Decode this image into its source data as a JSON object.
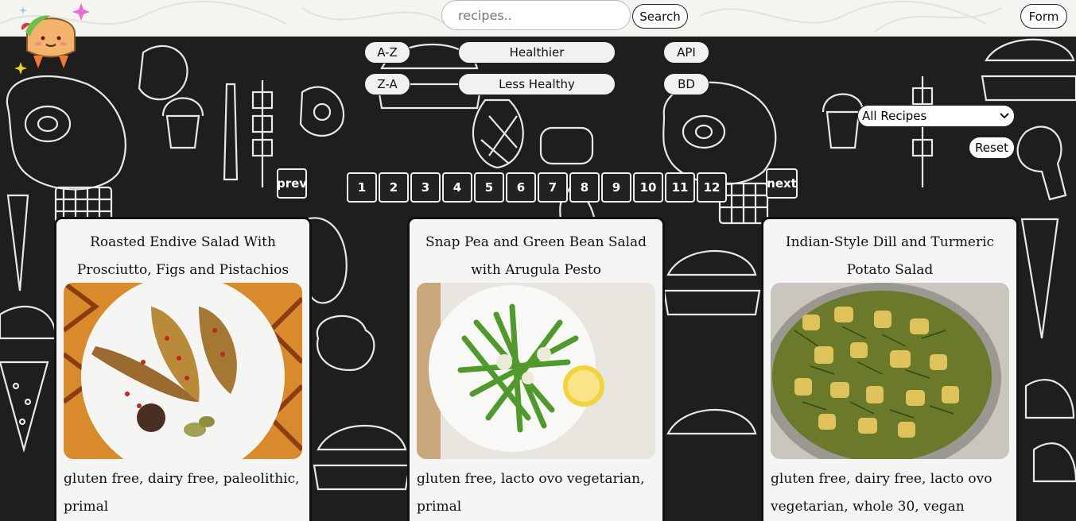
{
  "search": {
    "placeholder": "recipes..",
    "button_label": "Search"
  },
  "header": {
    "form_label": "Form"
  },
  "filters": {
    "az": "A-Z",
    "za": "Z-A",
    "healthier": "Healthier",
    "less_healthy": "Less Healthy",
    "api": "API",
    "bd": "BD"
  },
  "select": {
    "selected": "All Recipes"
  },
  "reset_label": "Reset",
  "pagination": {
    "prev": "prev",
    "next": "next",
    "pages": [
      "1",
      "2",
      "3",
      "4",
      "5",
      "6",
      "7",
      "8",
      "9",
      "10",
      "11",
      "12"
    ]
  },
  "cards": [
    {
      "title": "Roasted Endive Salad With Prosciutto, Figs and Pistachios",
      "tags": "gluten free, dairy free, paleolithic, primal",
      "image": "endive-salad-photo"
    },
    {
      "title": "Snap Pea and Green Bean Salad with Arugula Pesto",
      "tags": "gluten free, lacto ovo vegetarian, primal",
      "image": "green-bean-salad-photo"
    },
    {
      "title": "Indian-Style Dill and Turmeric Potato Salad",
      "tags": "gluten free, dairy free, lacto ovo vegetarian, whole 30, vegan",
      "image": "potato-salad-photo"
    }
  ],
  "icons": {
    "logo": "taco-logo",
    "select_arrow": "chevron-down-icon"
  }
}
